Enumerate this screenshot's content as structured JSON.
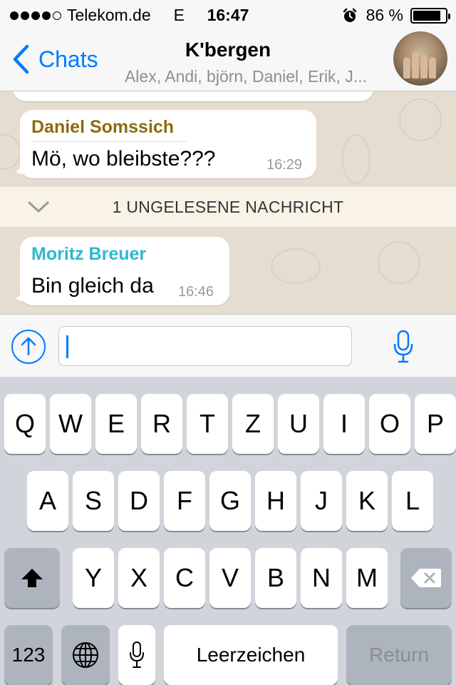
{
  "status_bar": {
    "signal_dots": [
      true,
      true,
      true,
      true,
      false
    ],
    "carrier": "Telekom.de",
    "network": "E",
    "time": "16:47",
    "alarm_icon": "alarm-clock-icon",
    "battery_percent": "86 %",
    "battery_level": 0.86
  },
  "nav": {
    "back_label": "Chats",
    "title": "K'bergen",
    "subtitle": "Alex, Andi, björn, Daniel, Erik, J..."
  },
  "chat": {
    "messages": [
      {
        "sender": "Daniel Somssich",
        "sender_color": "#8a6d10",
        "text": "Mö, wo bleibste???",
        "time": "16:29"
      },
      {
        "sender": "Moritz Breuer",
        "sender_color": "#2fb7d0",
        "text": "Bin gleich da",
        "time": "16:46"
      }
    ],
    "unread_banner": "1 UNGELESENE NACHRICHT"
  },
  "input": {
    "text": ""
  },
  "keyboard": {
    "row1": [
      "Q",
      "W",
      "E",
      "R",
      "T",
      "Z",
      "U",
      "I",
      "O",
      "P"
    ],
    "row2": [
      "A",
      "S",
      "D",
      "F",
      "G",
      "H",
      "J",
      "K",
      "L"
    ],
    "row3": [
      "Y",
      "X",
      "C",
      "V",
      "B",
      "N",
      "M"
    ],
    "numbers_key": "123",
    "space_key": "Leerzeichen",
    "return_key": "Return"
  },
  "colors": {
    "accent": "#007aff",
    "chat_background": "#e6ddd1",
    "keyboard_background": "#d1d5db"
  }
}
